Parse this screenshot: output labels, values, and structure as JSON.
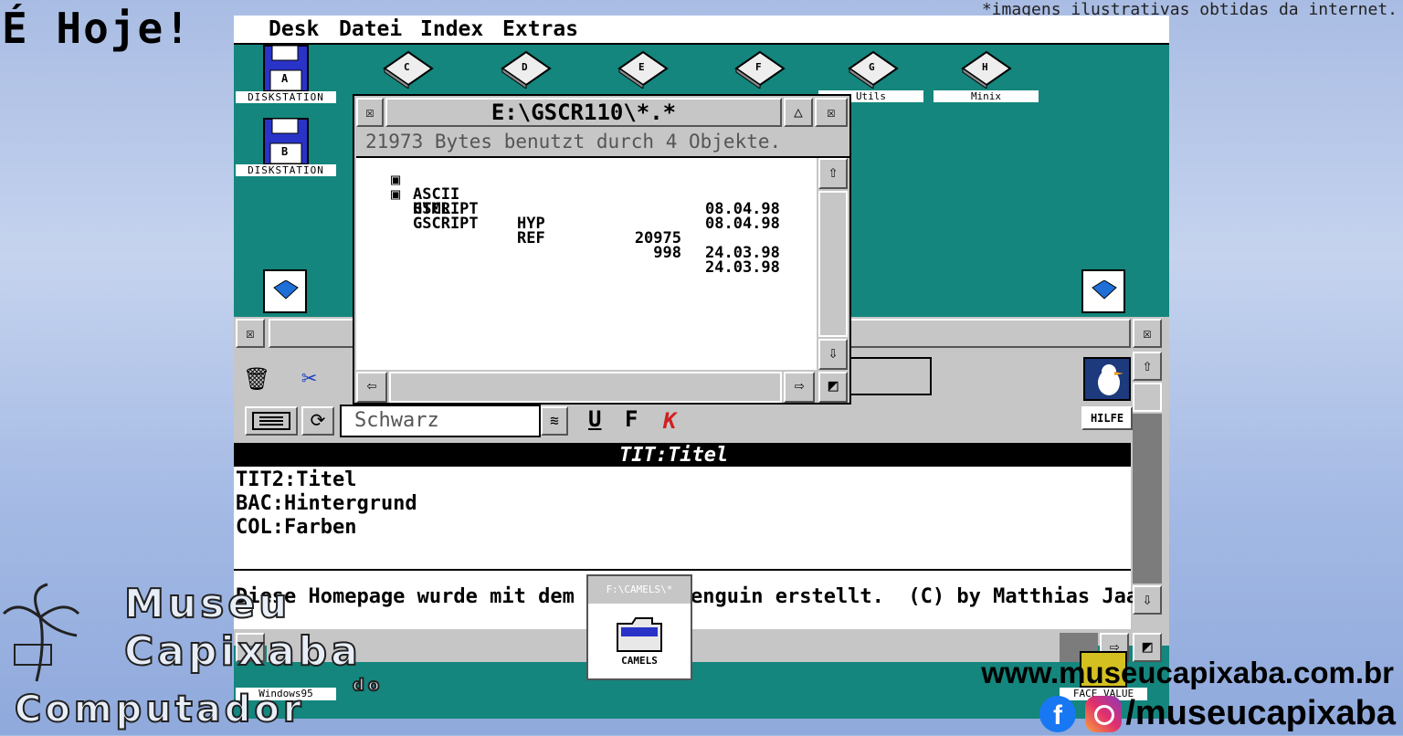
{
  "overlay": {
    "hoje": "É Hoje!",
    "disclaimer": "*imagens ilustrativas obtidas da internet.",
    "url": "www.museucapixaba.com.br",
    "handle": "/museucapixaba",
    "logo": {
      "line1": "Museu",
      "line2": "Capixaba",
      "line3": "do",
      "line4": "Computador"
    }
  },
  "menubar": {
    "items": [
      "Desk",
      "Datei",
      "Index",
      "Extras"
    ]
  },
  "desktop": {
    "icons": [
      {
        "letter": "A",
        "label": "DISKSTATION"
      },
      {
        "letter": "B",
        "label": "DISKSTATION"
      },
      {
        "letter": "C",
        "label": ""
      },
      {
        "letter": "D",
        "label": ""
      },
      {
        "letter": "E",
        "label": ""
      },
      {
        "letter": "F",
        "label": ""
      },
      {
        "letter": "G",
        "label": "Utils"
      },
      {
        "letter": "H",
        "label": "Minix"
      },
      {
        "letter": "",
        "label": "Windows95"
      },
      {
        "letter": "",
        "label": "FACE VALUE"
      }
    ]
  },
  "dir_window": {
    "title": "E:\\GSCR110\\*.*",
    "info": "21973 Bytes benutzt durch 4 Objekte.",
    "entries": [
      {
        "folder": true,
        "name": "ASCII",
        "ext": "",
        "size": "",
        "date": "08.04.98"
      },
      {
        "folder": true,
        "name": "HTML",
        "ext": "",
        "size": "",
        "date": "08.04.98"
      },
      {
        "folder": false,
        "name": "GSCRIPT",
        "ext": "HYP",
        "size": "20975",
        "date": "24.03.98"
      },
      {
        "folder": false,
        "name": "GSCRIPT",
        "ext": "REF",
        "size": "998",
        "date": "24.03.98"
      }
    ]
  },
  "editor": {
    "font_field": "Schwarz",
    "style_buttons": [
      "U",
      "F",
      "K"
    ],
    "help_button": "HILFE",
    "heading": "TIT:Titel",
    "lines": [
      "TIT2:Titel",
      "BAC:Hintergrund",
      "COL:Farben"
    ],
    "footer_line": "Diese Homepage wurde mit dem H",
    "footer_line2": "enguin erstellt.  (C) by Matthias Jaap"
  },
  "camels_window": {
    "title": "F:\\CAMELS\\*",
    "icon_label": "CAMELS"
  }
}
